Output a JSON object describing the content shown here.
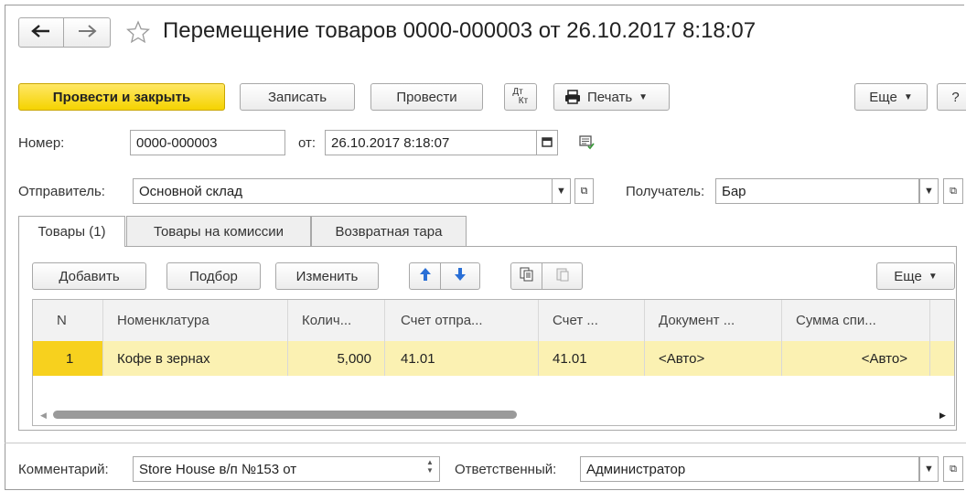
{
  "window": {
    "title": "Перемещение товаров 0000-000003 от 26.10.2017 8:18:07"
  },
  "icons": {
    "back": "arrow-left-icon",
    "forward": "arrow-right-icon",
    "favorite": "star-icon",
    "print": "printer-icon",
    "calendar": "calendar-icon",
    "dtkt": "dt-kt-icon"
  },
  "toolbar": {
    "post_and_close": "Провести и закрыть",
    "save": "Записать",
    "post": "Провести",
    "dtkt_top": "Дт",
    "dtkt_bottom": "Кт",
    "print": "Печать",
    "more": "Еще",
    "help": "?"
  },
  "header": {
    "number_label": "Номер:",
    "number_value": "0000-000003",
    "date_label": "от:",
    "date_value": "26.10.2017  8:18:07",
    "sender_label": "Отправитель:",
    "sender_value": "Основной склад",
    "receiver_label": "Получатель:",
    "receiver_value": "Бар"
  },
  "tabs": [
    {
      "label": "Товары (1)",
      "active": true
    },
    {
      "label": "Товары на комиссии",
      "active": false
    },
    {
      "label": "Возвратная тара",
      "active": false
    }
  ],
  "table_toolbar": {
    "add": "Добавить",
    "select": "Подбор",
    "edit": "Изменить",
    "more": "Еще"
  },
  "table": {
    "columns": [
      "N",
      "Номенклатура",
      "Колич...",
      "Счет отпра...",
      "Счет ...",
      "Документ ...",
      "Сумма спи..."
    ],
    "rows": [
      [
        "1",
        "Кофе в зернах",
        "5,000",
        "41.01",
        "41.01",
        "<Авто>",
        "<Авто>"
      ]
    ]
  },
  "footer": {
    "comment_label": "Комментарий:",
    "comment_value": "Store House в/п №153 от",
    "responsible_label": "Ответственный:",
    "responsible_value": "Администратор"
  },
  "colors": {
    "primary_button": "#f5d300",
    "selected_row": "#fbf1b2",
    "selected_cell": "#f7d11e",
    "border": "#a8a8a8"
  }
}
